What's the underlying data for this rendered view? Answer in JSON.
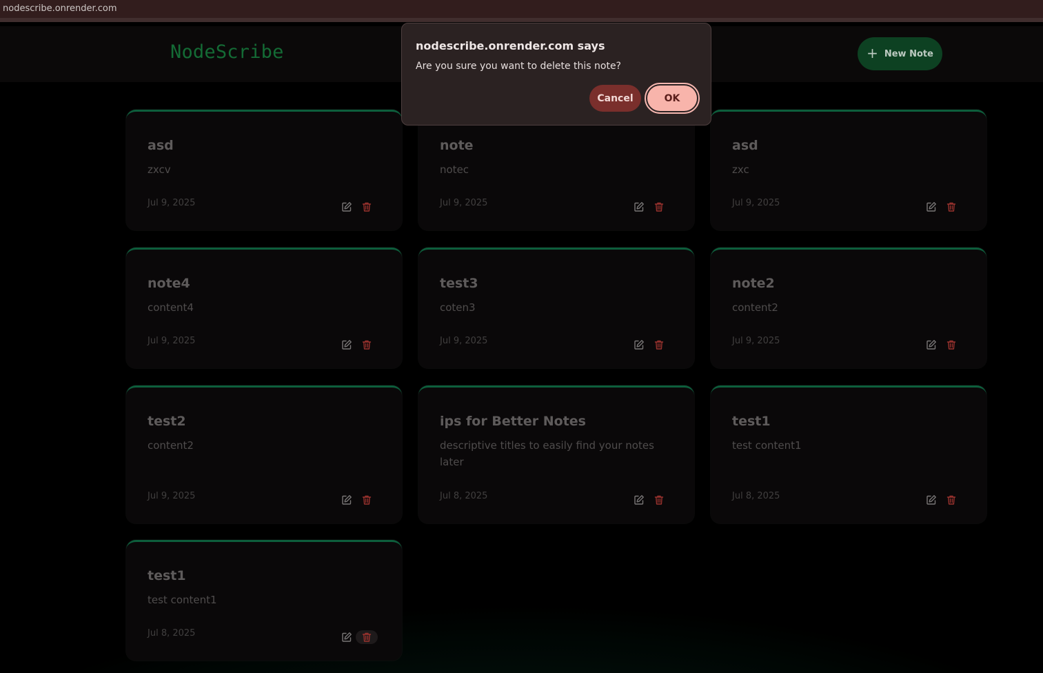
{
  "browser": {
    "url": "nodescribe.onrender.com"
  },
  "header": {
    "logo": "NodeScribe",
    "new_note_label": "New Note",
    "new_note_icon": "plus-icon",
    "accent": "#177a3d"
  },
  "notes": [
    {
      "title": "asd",
      "content": "zxcv",
      "date": "Jul 9, 2025"
    },
    {
      "title": "note",
      "content": "notec",
      "date": "Jul 9, 2025"
    },
    {
      "title": "asd",
      "content": "zxc",
      "date": "Jul 9, 2025"
    },
    {
      "title": "note4",
      "content": "content4",
      "date": "Jul 9, 2025"
    },
    {
      "title": "test3",
      "content": "coten3",
      "date": "Jul 9, 2025"
    },
    {
      "title": "note2",
      "content": "content2",
      "date": "Jul 9, 2025"
    },
    {
      "title": "test2",
      "content": "content2",
      "date": "Jul 9, 2025"
    },
    {
      "title": "ips for Better Notes",
      "content": "descriptive titles to easily find your notes later",
      "date": "Jul 8, 2025"
    },
    {
      "title": "test1",
      "content": "test content1",
      "date": "Jul 8, 2025"
    },
    {
      "title": "test1",
      "content": "test content1",
      "date": "Jul 8, 2025"
    }
  ],
  "note_icons": {
    "edit": "edit-icon",
    "delete": "trash-icon"
  },
  "dialog": {
    "title": "nodescribe.onrender.com says",
    "message": "Are you sure you want to delete this note?",
    "cancel_label": "Cancel",
    "ok_label": "OK"
  },
  "colors": {
    "card_border": "#0f6b45",
    "delete": "#b03a35",
    "cancel_bg": "#7a2f2c",
    "ok_bg": "#f8b4ab"
  }
}
